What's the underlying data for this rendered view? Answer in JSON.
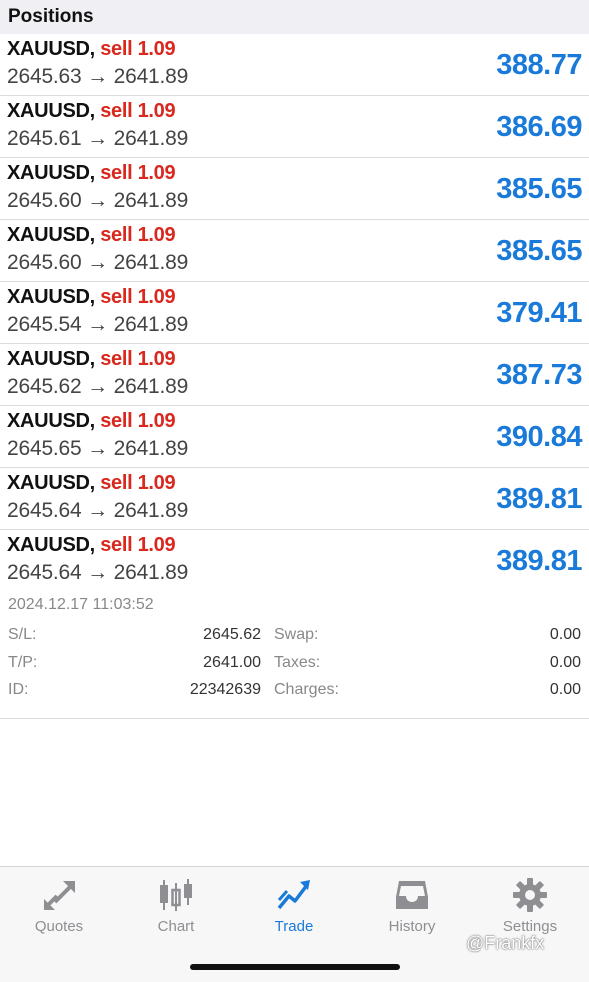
{
  "header": {
    "title": "Positions"
  },
  "positions": [
    {
      "symbol": "XAUUSD,",
      "side": "sell 1.09",
      "open": "2645.63",
      "current": "2641.89",
      "profit": "388.77"
    },
    {
      "symbol": "XAUUSD,",
      "side": "sell 1.09",
      "open": "2645.61",
      "current": "2641.89",
      "profit": "386.69"
    },
    {
      "symbol": "XAUUSD,",
      "side": "sell 1.09",
      "open": "2645.60",
      "current": "2641.89",
      "profit": "385.65"
    },
    {
      "symbol": "XAUUSD,",
      "side": "sell 1.09",
      "open": "2645.60",
      "current": "2641.89",
      "profit": "385.65"
    },
    {
      "symbol": "XAUUSD,",
      "side": "sell 1.09",
      "open": "2645.54",
      "current": "2641.89",
      "profit": "379.41"
    },
    {
      "symbol": "XAUUSD,",
      "side": "sell 1.09",
      "open": "2645.62",
      "current": "2641.89",
      "profit": "387.73"
    },
    {
      "symbol": "XAUUSD,",
      "side": "sell 1.09",
      "open": "2645.65",
      "current": "2641.89",
      "profit": "390.84"
    },
    {
      "symbol": "XAUUSD,",
      "side": "sell 1.09",
      "open": "2645.64",
      "current": "2641.89",
      "profit": "389.81"
    },
    {
      "symbol": "XAUUSD,",
      "side": "sell 1.09",
      "open": "2645.64",
      "current": "2641.89",
      "profit": "389.81"
    }
  ],
  "arrow": "→",
  "details": {
    "timestamp": "2024.12.17 11:03:52",
    "sl_label": "S/L:",
    "sl_value": "2645.62",
    "tp_label": "T/P:",
    "tp_value": "2641.00",
    "id_label": "ID:",
    "id_value": "22342639",
    "swap_label": "Swap:",
    "swap_value": "0.00",
    "taxes_label": "Taxes:",
    "taxes_value": "0.00",
    "charges_label": "Charges:",
    "charges_value": "0.00"
  },
  "tabs": [
    {
      "label": "Quotes",
      "icon": "quotes-arrows-icon",
      "active": false
    },
    {
      "label": "Chart",
      "icon": "candlestick-icon",
      "active": false
    },
    {
      "label": "Trade",
      "icon": "trade-trend-icon",
      "active": true
    },
    {
      "label": "History",
      "icon": "inbox-tray-icon",
      "active": false
    },
    {
      "label": "Settings",
      "icon": "gear-icon",
      "active": false
    }
  ],
  "watermark": "@Frankfx",
  "colors": {
    "accent_blue": "#1a7ad9",
    "sell_red": "#d9281e",
    "inactive_gray": "#8e8e93"
  }
}
